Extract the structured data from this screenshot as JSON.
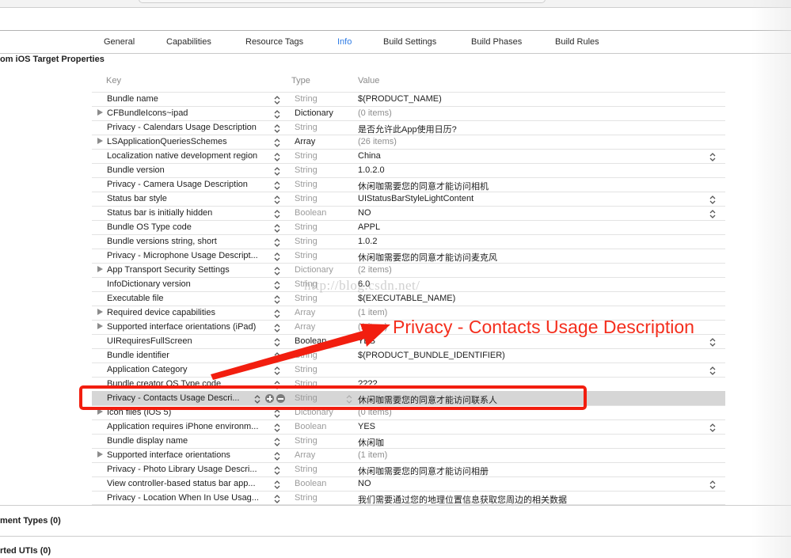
{
  "tabs": [
    {
      "label": "General",
      "active": false
    },
    {
      "label": "Capabilities",
      "active": false
    },
    {
      "label": "Resource Tags",
      "active": false
    },
    {
      "label": "Info",
      "active": true
    },
    {
      "label": "Build Settings",
      "active": false
    },
    {
      "label": "Build Phases",
      "active": false
    },
    {
      "label": "Build Rules",
      "active": false
    }
  ],
  "sections": {
    "target_properties": "om iOS Target Properties",
    "document_types": "ment Types (0)",
    "exported_utis": "rted UTIs (0)"
  },
  "columns": {
    "key": "Key",
    "type": "Type",
    "value": "Value"
  },
  "rows": [
    {
      "key": "Bundle name",
      "type": "String",
      "value": "$(PRODUCT_NAME)",
      "expandable": false,
      "value_stepper": false,
      "muted_value": false
    },
    {
      "key": "CFBundleIcons~ipad",
      "type": "Dictionary",
      "value": "(0 items)",
      "expandable": true,
      "value_stepper": false,
      "muted_value": true,
      "type_dark": true
    },
    {
      "key": "Privacy - Calendars Usage Description",
      "type": "String",
      "value": "是否允许此App使用日历?",
      "expandable": false,
      "value_stepper": false,
      "muted_value": false
    },
    {
      "key": "LSApplicationQueriesSchemes",
      "type": "Array",
      "value": "(26 items)",
      "expandable": true,
      "value_stepper": false,
      "muted_value": true,
      "type_dark": true
    },
    {
      "key": "Localization native development region",
      "type": "String",
      "value": "China",
      "expandable": false,
      "value_stepper": true,
      "muted_value": false
    },
    {
      "key": "Bundle version",
      "type": "String",
      "value": "1.0.2.0",
      "expandable": false,
      "value_stepper": false,
      "muted_value": false
    },
    {
      "key": "Privacy - Camera Usage Description",
      "type": "String",
      "value": "休闲咖需要您的同意才能访问相机",
      "expandable": false,
      "value_stepper": false,
      "muted_value": false
    },
    {
      "key": "Status bar style",
      "type": "String",
      "value": "UIStatusBarStyleLightContent",
      "expandable": false,
      "value_stepper": true,
      "muted_value": false
    },
    {
      "key": "Status bar is initially hidden",
      "type": "Boolean",
      "value": "NO",
      "expandable": false,
      "value_stepper": true,
      "muted_value": false
    },
    {
      "key": "Bundle OS Type code",
      "type": "String",
      "value": "APPL",
      "expandable": false,
      "value_stepper": false,
      "muted_value": false
    },
    {
      "key": "Bundle versions string, short",
      "type": "String",
      "value": "1.0.2",
      "expandable": false,
      "value_stepper": false,
      "muted_value": false
    },
    {
      "key": "Privacy - Microphone Usage Descript...",
      "type": "String",
      "value": "休闲咖需要您的同意才能访问麦克风",
      "expandable": false,
      "value_stepper": false,
      "muted_value": false
    },
    {
      "key": "App Transport Security Settings",
      "type": "Dictionary",
      "value": "(2 items)",
      "expandable": true,
      "value_stepper": false,
      "muted_value": true
    },
    {
      "key": "InfoDictionary version",
      "type": "String",
      "value": "6.0",
      "expandable": false,
      "value_stepper": false,
      "muted_value": false
    },
    {
      "key": "Executable file",
      "type": "String",
      "value": "$(EXECUTABLE_NAME)",
      "expandable": false,
      "value_stepper": false,
      "muted_value": false
    },
    {
      "key": "Required device capabilities",
      "type": "Array",
      "value": "(1 item)",
      "expandable": true,
      "value_stepper": false,
      "muted_value": true
    },
    {
      "key": "Supported interface orientations (iPad)",
      "type": "Array",
      "value": "(1 item)",
      "expandable": true,
      "value_stepper": false,
      "muted_value": true
    },
    {
      "key": "UIRequiresFullScreen",
      "type": "Boolean",
      "value": "YES",
      "expandable": false,
      "value_stepper": true,
      "muted_value": false,
      "type_dark": true
    },
    {
      "key": "Bundle identifier",
      "type": "String",
      "value": "$(PRODUCT_BUNDLE_IDENTIFIER)",
      "expandable": false,
      "value_stepper": false,
      "muted_value": false
    },
    {
      "key": "Application Category",
      "type": "String",
      "value": "",
      "expandable": false,
      "value_stepper": true,
      "muted_value": false
    },
    {
      "key": "Bundle creator OS Type code",
      "type": "String",
      "value": "????",
      "expandable": false,
      "value_stepper": false,
      "muted_value": false
    },
    {
      "key": "Privacy - Contacts Usage Descri...",
      "type": "String",
      "value": "休闲咖需要您的同意才能访问联系人",
      "expandable": false,
      "value_stepper": false,
      "muted_value": false,
      "selected": true
    },
    {
      "key": "Icon files (iOS 5)",
      "type": "Dictionary",
      "value": "(0 items)",
      "expandable": true,
      "value_stepper": false,
      "muted_value": true
    },
    {
      "key": "Application requires iPhone environm...",
      "type": "Boolean",
      "value": "YES",
      "expandable": false,
      "value_stepper": true,
      "muted_value": false
    },
    {
      "key": "Bundle display name",
      "type": "String",
      "value": "休闲咖",
      "expandable": false,
      "value_stepper": false,
      "muted_value": false
    },
    {
      "key": "Supported interface orientations",
      "type": "Array",
      "value": "(1 item)",
      "expandable": true,
      "value_stepper": false,
      "muted_value": true
    },
    {
      "key": "Privacy - Photo Library Usage Descri...",
      "type": "String",
      "value": "休闲咖需要您的同意才能访问相册",
      "expandable": false,
      "value_stepper": false,
      "muted_value": false
    },
    {
      "key": "View controller-based status bar app...",
      "type": "Boolean",
      "value": "NO",
      "expandable": false,
      "value_stepper": true,
      "muted_value": false
    },
    {
      "key": "Privacy - Location When In Use Usag...",
      "type": "String",
      "value": "我们需要通过您的地理位置信息获取您周边的相关数据",
      "expandable": false,
      "value_stepper": false,
      "muted_value": false
    }
  ],
  "watermark": "http://blog.csdn.net/",
  "annotation": {
    "label": "Privacy - Contacts Usage Description",
    "color": "#f21e0f"
  },
  "colors": {
    "accent": "#2d7be5",
    "selected_row": "#d6d6d6"
  }
}
